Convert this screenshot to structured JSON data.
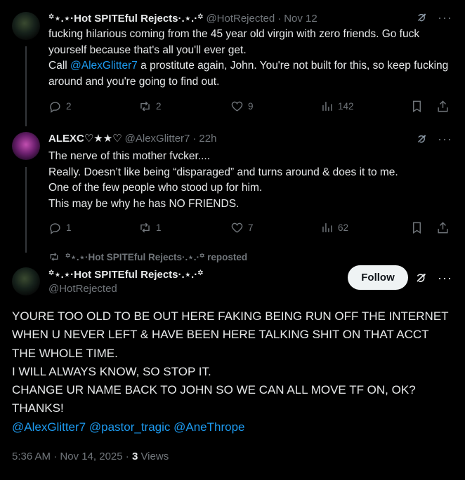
{
  "replies": [
    {
      "display_name": "꙳⋆.⋆·Hot SPITEful Rejects·.⋆.·꙳",
      "handle": "@HotRejected",
      "dot": "·",
      "time": "Nov 12",
      "lines": [
        [
          "fucking hilarious coming from the 45 year old virgin with zero friends. Go fuck yourself because that's all you'll ever get."
        ],
        [
          "Call ",
          {
            "mention": "@AlexGlitter7"
          },
          " a prostitute again, John. You're not built for this, so keep fucking around and you're going to find out."
        ]
      ],
      "replies_count": "2",
      "reposts_count": "2",
      "likes_count": "9",
      "views_count": "142"
    },
    {
      "display_name": "ALEXC♡★★♡",
      "handle": "@AlexGlitter7",
      "dot": "·",
      "time": "22h",
      "lines": [
        [
          "The nerve of this mother fvcker...."
        ],
        [
          "Really. Doesn’t like being “disparaged” and turns around & does it to me."
        ],
        [
          "One of the few people who stood up for him."
        ],
        [
          "This may be why he has NO FRIENDS."
        ]
      ],
      "replies_count": "1",
      "reposts_count": "1",
      "likes_count": "7",
      "views_count": "62"
    }
  ],
  "repost_notice": "꙳⋆.⋆·Hot SPITEful Rejects·.⋆.·꙳ reposted",
  "main_tweet": {
    "display_name": "꙳⋆.⋆·Hot SPITEful Rejects·.⋆.·꙳",
    "handle": "@HotRejected",
    "follow_label": "Follow",
    "lines": [
      "YOURE TOO OLD TO BE OUT HERE FAKING BEING RUN OFF THE INTERNET WHEN U NEVER LEFT & HAVE BEEN HERE TALKING SHIT ON THAT ACCT THE WHOLE TIME.",
      "I WILL ALWAYS KNOW, SO STOP IT.",
      "CHANGE UR NAME BACK TO JOHN SO WE CAN ALL MOVE TF ON, OK?",
      "THANKS!"
    ],
    "mentions": [
      "@AlexGlitter7",
      "@pastor_tragic",
      "@AneThrope"
    ],
    "timestamp": "5:36 AM · Nov 14, 2025 · ",
    "views_count": "3",
    "views_label": " Views"
  },
  "colors": {
    "background": "#000000",
    "text": "#e7e9ea",
    "muted": "#71767b",
    "link": "#1d9bf0"
  }
}
